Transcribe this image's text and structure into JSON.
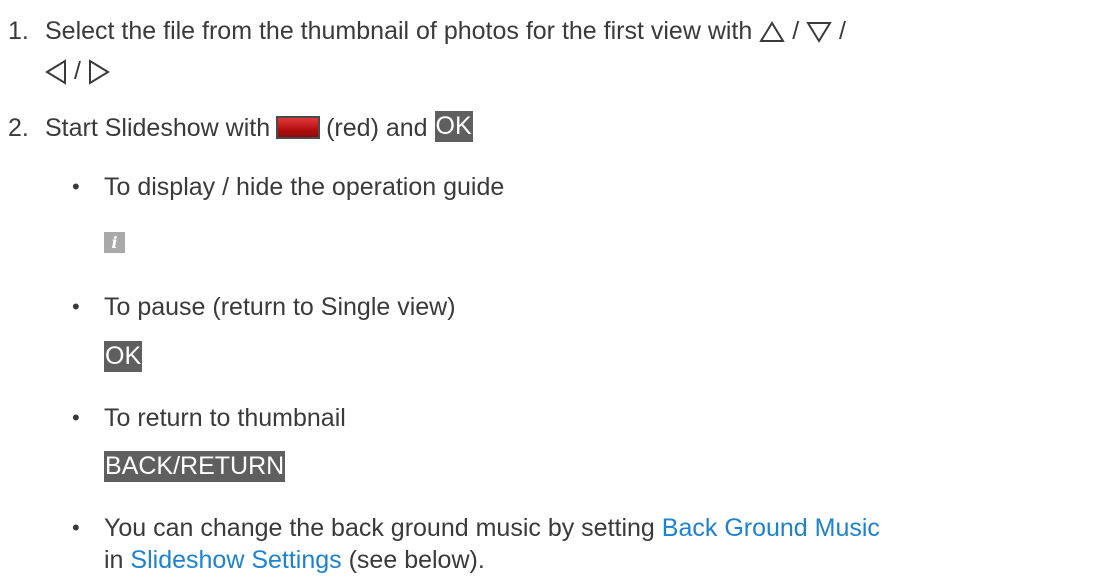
{
  "steps": [
    {
      "number": "1.",
      "line1": "Select the file from the thumbnail of photos for the first view with",
      "sep": "/",
      "icons": [
        "up-arrow-icon",
        "down-arrow-icon",
        "left-arrow-icon",
        "right-arrow-icon"
      ]
    },
    {
      "number": "2.",
      "text_before": "Start Slideshow with",
      "color_label": "(red) and",
      "ok_key": "OK",
      "red_color": "#c81818"
    }
  ],
  "bullets": [
    {
      "text": "To display / hide the operation guide",
      "key_icon": "info-icon",
      "icon_glyph": "i"
    },
    {
      "text": "To pause (return to Single view)",
      "key": "OK"
    },
    {
      "text": "To return to thumbnail",
      "key": "BACK/RETURN"
    },
    {
      "text_before": "You can change the back ground music by setting",
      "link1": "Back Ground Music",
      "line2_before": "in",
      "link2": "Slideshow Settings",
      "line2_after": "(see below)."
    }
  ],
  "colors": {
    "text": "#3a3a3a",
    "link": "#1e82cf",
    "key_bg": "#5f5f5f"
  }
}
